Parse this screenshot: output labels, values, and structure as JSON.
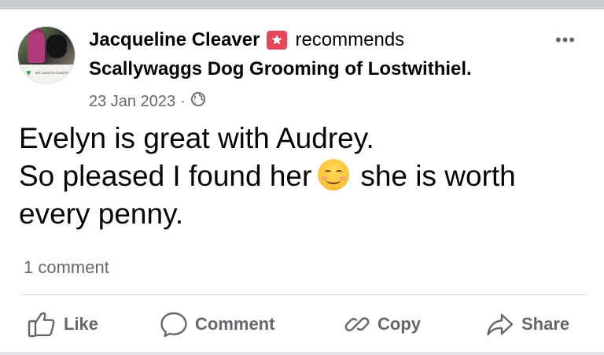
{
  "post": {
    "author_name": "Jacqueline Cleaver",
    "recommendation_verb": "recommends",
    "business_name": "Scallywaggs Dog Grooming of Lostwithiel.",
    "date": "23 Jan 2023",
    "separator": "·",
    "privacy_icon": "globe-icon",
    "avatar_banner_text": "#PLYMOUTHTOGETHER",
    "body_lines": {
      "line1": "Evelyn is great with Audrey.",
      "line2_before": "So pleased I found her",
      "line2_after": "she is worth",
      "line3": "every penny."
    },
    "emoji": "smiling-face-emoji",
    "comment_count": "1 comment"
  },
  "actions": {
    "like": "Like",
    "comment": "Comment",
    "copy": "Copy",
    "share": "Share"
  },
  "colors": {
    "text_primary": "#050505",
    "text_secondary": "#65676b",
    "recommend_badge": "#e8475a",
    "divider": "#ced0d4"
  }
}
